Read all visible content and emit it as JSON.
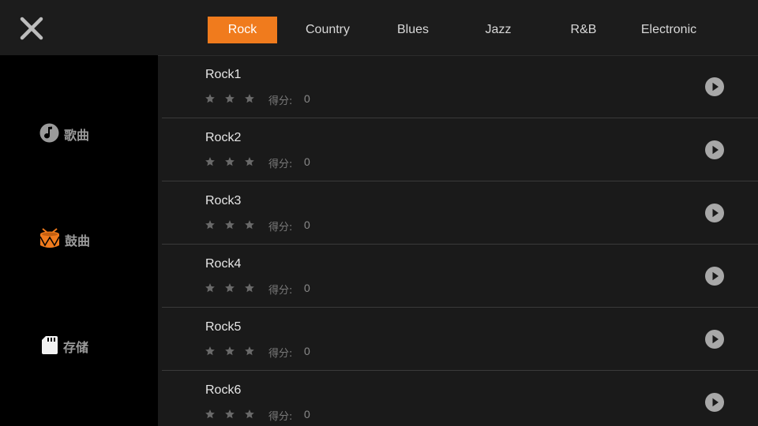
{
  "tabs": [
    {
      "label": "Rock",
      "active": true
    },
    {
      "label": "Country",
      "active": false
    },
    {
      "label": "Blues",
      "active": false
    },
    {
      "label": "Jazz",
      "active": false
    },
    {
      "label": "R&B",
      "active": false
    },
    {
      "label": "Electronic",
      "active": false
    }
  ],
  "sidebar": {
    "items": [
      {
        "label": "歌曲",
        "icon": "music-note-icon"
      },
      {
        "label": "鼓曲",
        "icon": "drum-icon"
      },
      {
        "label": "存储",
        "icon": "sd-card-icon"
      }
    ]
  },
  "songs": [
    {
      "title": "Rock1",
      "score_label": "得分:",
      "score": "0",
      "stars": 0
    },
    {
      "title": "Rock2",
      "score_label": "得分:",
      "score": "0",
      "stars": 0
    },
    {
      "title": "Rock3",
      "score_label": "得分:",
      "score": "0",
      "stars": 0
    },
    {
      "title": "Rock4",
      "score_label": "得分:",
      "score": "0",
      "stars": 0
    },
    {
      "title": "Rock5",
      "score_label": "得分:",
      "score": "0",
      "stars": 0
    },
    {
      "title": "Rock6",
      "score_label": "得分:",
      "score": "0",
      "stars": 0
    }
  ],
  "colors": {
    "accent": "#f07b1d",
    "star_empty": "#6a6a6a",
    "play_icon": "#a8a8a8"
  }
}
